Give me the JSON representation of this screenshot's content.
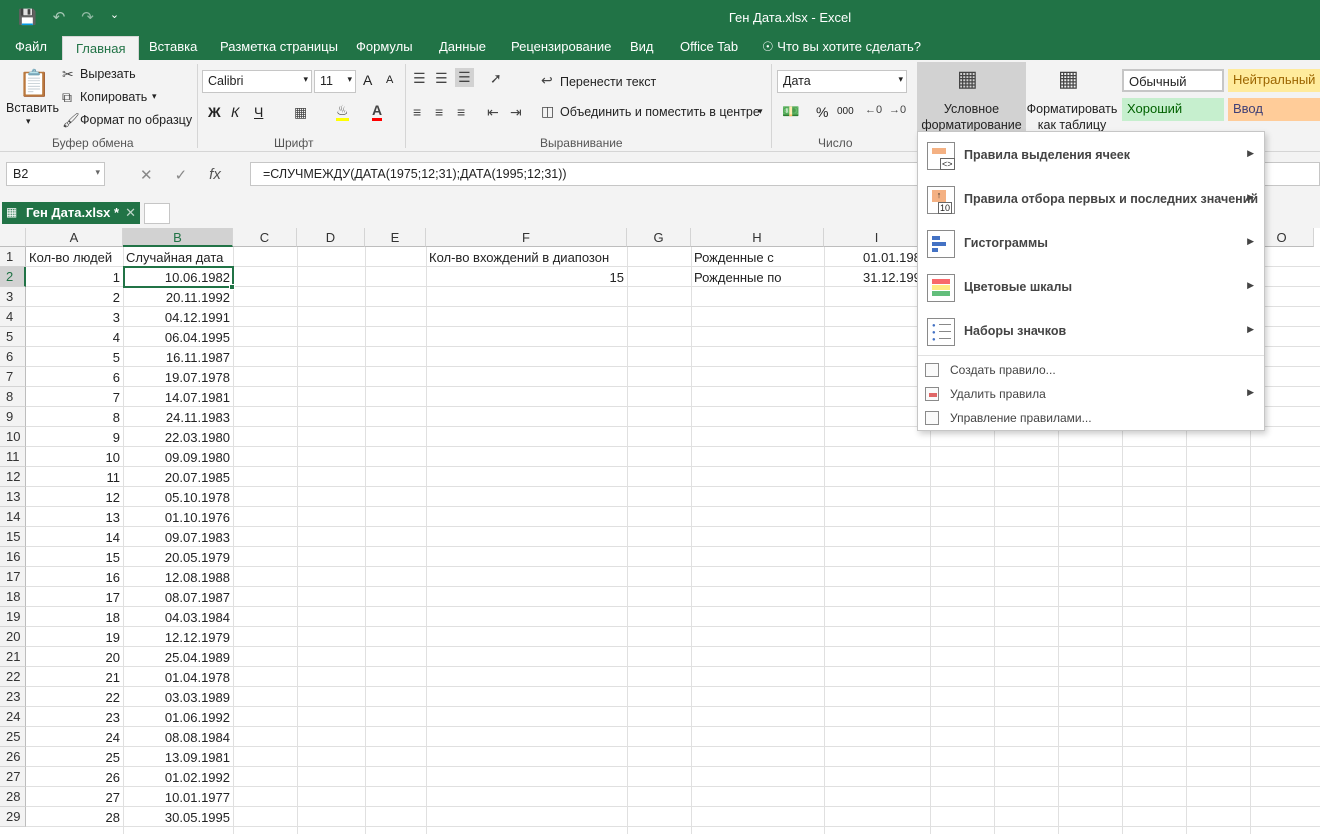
{
  "window": {
    "title": "Ген Дата.xlsx - Excel"
  },
  "tabs": [
    "Файл",
    "Главная",
    "Вставка",
    "Разметка страницы",
    "Формулы",
    "Данные",
    "Рецензирование",
    "Вид",
    "Office Tab"
  ],
  "tell_me": "Что вы хотите сделать?",
  "clipboard": {
    "paste": "Вставить",
    "cut": "Вырезать",
    "copy": "Копировать",
    "format_painter": "Формат по образцу",
    "group": "Буфер обмена"
  },
  "font": {
    "name": "Calibri",
    "size": "11",
    "group": "Шрифт",
    "bold": "Ж",
    "italic": "К",
    "underline": "Ч",
    "grow": "A",
    "shrink": "A"
  },
  "alignment": {
    "wrap": "Перенести текст",
    "merge": "Объединить и поместить в центре",
    "group": "Выравнивание"
  },
  "number": {
    "format": "Дата",
    "percent": "%",
    "thousands": "000",
    "group": "Число"
  },
  "styles": {
    "cond_format": "Условное форматирование",
    "format_table": "Форматировать как таблицу",
    "normal": "Обычный",
    "neutral": "Нейтральный",
    "good": "Хороший",
    "input": "Ввод",
    "neutral_color": "#ffeb9c",
    "good_color": "#c6efce",
    "input_color": "#ffcc99"
  },
  "formula_bar": {
    "name_box": "B2",
    "fx": "fx",
    "formula": "=СЛУЧМЕЖДУ(ДАТА(1975;12;31);ДАТА(1995;12;31))"
  },
  "doc_tab": {
    "label": "Ген Дата.xlsx *"
  },
  "columns": [
    "A",
    "B",
    "C",
    "D",
    "E",
    "F",
    "G",
    "H",
    "I",
    "O"
  ],
  "rows": [
    "1",
    "2",
    "3",
    "4",
    "5",
    "6",
    "7",
    "8",
    "9",
    "10",
    "11",
    "12",
    "13",
    "14",
    "15",
    "16",
    "17",
    "18",
    "19",
    "20",
    "21",
    "22",
    "23",
    "24",
    "25",
    "26",
    "27",
    "28",
    "29"
  ],
  "sheet": {
    "a1": "Кол-во людей",
    "b1": "Случайная дата",
    "f1": "Кол-во вхождений в диапозон",
    "f2": "15",
    "h1": "Рожденные с",
    "h2": "Рожденные по",
    "i1": "01.01.198",
    "i2": "31.12.199",
    "data": [
      [
        "1",
        "10.06.1982"
      ],
      [
        "2",
        "20.11.1992"
      ],
      [
        "3",
        "04.12.1991"
      ],
      [
        "4",
        "06.04.1995"
      ],
      [
        "5",
        "16.11.1987"
      ],
      [
        "6",
        "19.07.1978"
      ],
      [
        "7",
        "14.07.1981"
      ],
      [
        "8",
        "24.11.1983"
      ],
      [
        "9",
        "22.03.1980"
      ],
      [
        "10",
        "09.09.1980"
      ],
      [
        "11",
        "20.07.1985"
      ],
      [
        "12",
        "05.10.1978"
      ],
      [
        "13",
        "01.10.1976"
      ],
      [
        "14",
        "09.07.1983"
      ],
      [
        "15",
        "20.05.1979"
      ],
      [
        "16",
        "12.08.1988"
      ],
      [
        "17",
        "08.07.1987"
      ],
      [
        "18",
        "04.03.1984"
      ],
      [
        "19",
        "12.12.1979"
      ],
      [
        "20",
        "25.04.1989"
      ],
      [
        "21",
        "01.04.1978"
      ],
      [
        "22",
        "03.03.1989"
      ],
      [
        "23",
        "01.06.1992"
      ],
      [
        "24",
        "08.08.1984"
      ],
      [
        "25",
        "13.09.1981"
      ],
      [
        "26",
        "01.02.1992"
      ],
      [
        "27",
        "10.01.1977"
      ],
      [
        "28",
        "30.05.1995"
      ]
    ]
  },
  "menu": {
    "highlight": "Правила выделения ячеек",
    "topbottom": "Правила отбора первых и последних значений",
    "databars": "Гистограммы",
    "colorscales": "Цветовые шкалы",
    "iconsets": "Наборы значков",
    "new_rule": "Создать правило...",
    "clear_rules": "Удалить правила",
    "manage_rules": "Управление правилами..."
  }
}
